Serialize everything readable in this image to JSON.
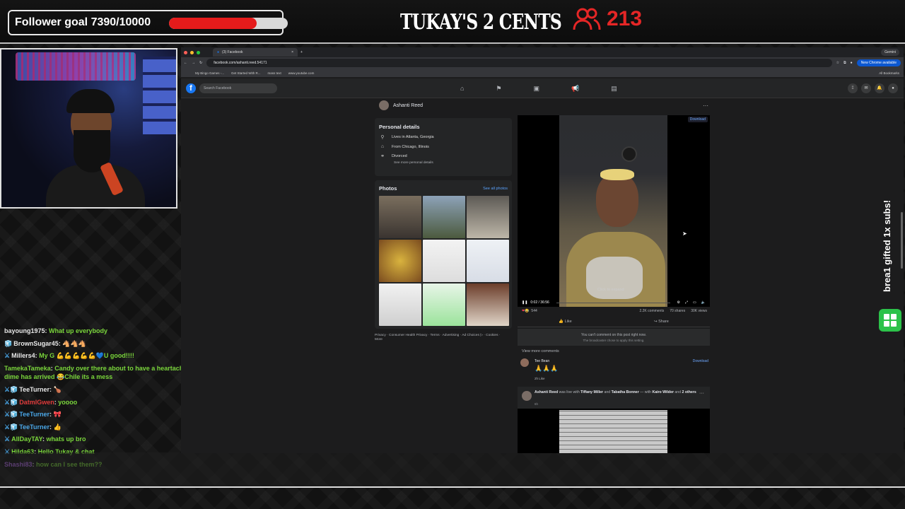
{
  "overlay": {
    "follower_goal": "Follower goal 7390/10000",
    "follower_progress": 0.739,
    "brand": "TUKAY'S 2 CENTS",
    "viewer_count": "213",
    "accent_red": "#e51b1b"
  },
  "sub_alert": {
    "text": "brea1 gifted 1x subs!"
  },
  "chat": [
    {
      "user": "bayoung1975",
      "color": "#e8e8e8",
      "sep": ": ",
      "text": "What up everybody",
      "text_color": "#7ad63b",
      "badge": ""
    },
    {
      "user": "BrownSugar45",
      "color": "#e8e8e8",
      "sep": ": ",
      "text": "🐴🐴🐴",
      "text_color": "#7ad63b",
      "badge": "🧊"
    },
    {
      "user": "Millers4",
      "color": "#e8e8e8",
      "sep": ": ",
      "text": "My G 💪💪💪💪💪💙U good!!!!",
      "text_color": "#7ad63b",
      "badge": "⚔"
    },
    {
      "user": "TamekaTameka",
      "color": "#7ad63b",
      "sep": ": ",
      "text": "Candy over there about to have a heartache cause dime has arrived 😂Chile its a mess",
      "text_color": "#7ad63b",
      "badge": ""
    },
    {
      "user": "TeeTurner",
      "color": "#e8e8e8",
      "sep": ": ",
      "text": "🍗",
      "text_color": "#7ad63b",
      "badge": "⚔🧊"
    },
    {
      "user": "DatmlGwen",
      "color": "#e03b3b",
      "sep": ": ",
      "text": "yoooo",
      "text_color": "#7ad63b",
      "badge": "⚔🧊"
    },
    {
      "user": "TeeTurner",
      "color": "#4aa7e8",
      "sep": ": ",
      "text": "🎀",
      "text_color": "#7ad63b",
      "badge": "⚔🧊"
    },
    {
      "user": "TeeTurner",
      "color": "#4aa7e8",
      "sep": ": ",
      "text": "👍",
      "text_color": "#7ad63b",
      "badge": "⚔🧊"
    },
    {
      "user": "AllDayTAY",
      "color": "#7ad63b",
      "sep": ": ",
      "text": "whats up bro",
      "text_color": "#7ad63b",
      "badge": "⚔"
    },
    {
      "user": "Hilda63",
      "color": "#7ad63b",
      "sep": ": ",
      "text": "Hello Tukay & chat",
      "text_color": "#7ad63b",
      "badge": "⚔"
    },
    {
      "user": "Shashi83",
      "color": "#b36bea",
      "sep": ": ",
      "text": "how can I see them??",
      "text_color": "#7ad63b",
      "badge": ""
    }
  ],
  "browser": {
    "tab_title": "(3) Facebook",
    "tab_close": "×",
    "new_tab": "+",
    "gemini": "Gemini",
    "url": "facebook.com/ashanti.reed.54171",
    "new_chrome": "New Chrome available",
    "bookmarks": [
      "My Bingo Games -...",
      "Get Started With R...",
      "mass text",
      "www.youtube.com"
    ],
    "all_bookmarks": "All Bookmarks"
  },
  "facebook": {
    "search_placeholder": "Search Facebook",
    "profile_name": "Ashanti Reed",
    "personal_details": {
      "title": "Personal details",
      "lives": "Lives in Atlanta, Georgia",
      "from": "From Chicago, Illinois",
      "status": "Divorced",
      "see_more": "See more personal details"
    },
    "photos": {
      "title": "Photos",
      "see_all": "See all photos"
    },
    "footer": "Privacy · Consumer Health Privacy · Terms · Advertising · Ad Choices ▷ · Cookies · More",
    "video": {
      "download": "Download",
      "click_expand": "Click to expand",
      "time": "0:02 / 36:56",
      "reaction_count": "544",
      "comments": "2.2K comments",
      "shares": "70 shares",
      "views": "30K views",
      "like": "Like",
      "share": "Share",
      "cant_comment": "You can't comment on this post right now.",
      "cant_comment_sub": "The broadcaster chose to apply this setting.",
      "view_more": "View more comments"
    },
    "comment": {
      "name": "Tee Bean",
      "emoji": "🙏🙏🙏",
      "meta": "2h   Like",
      "download": "Download"
    },
    "post2": {
      "author": "Ashanti Reed",
      "was_live": " was live with ",
      "with1": "Tiffany Miller",
      "and": " and ",
      "with2": "Tabatha Bonner",
      "dash": " — with ",
      "with3": "Kairo Wilder",
      "and2": " and ",
      "others": "2 others",
      "time": "6h"
    }
  }
}
